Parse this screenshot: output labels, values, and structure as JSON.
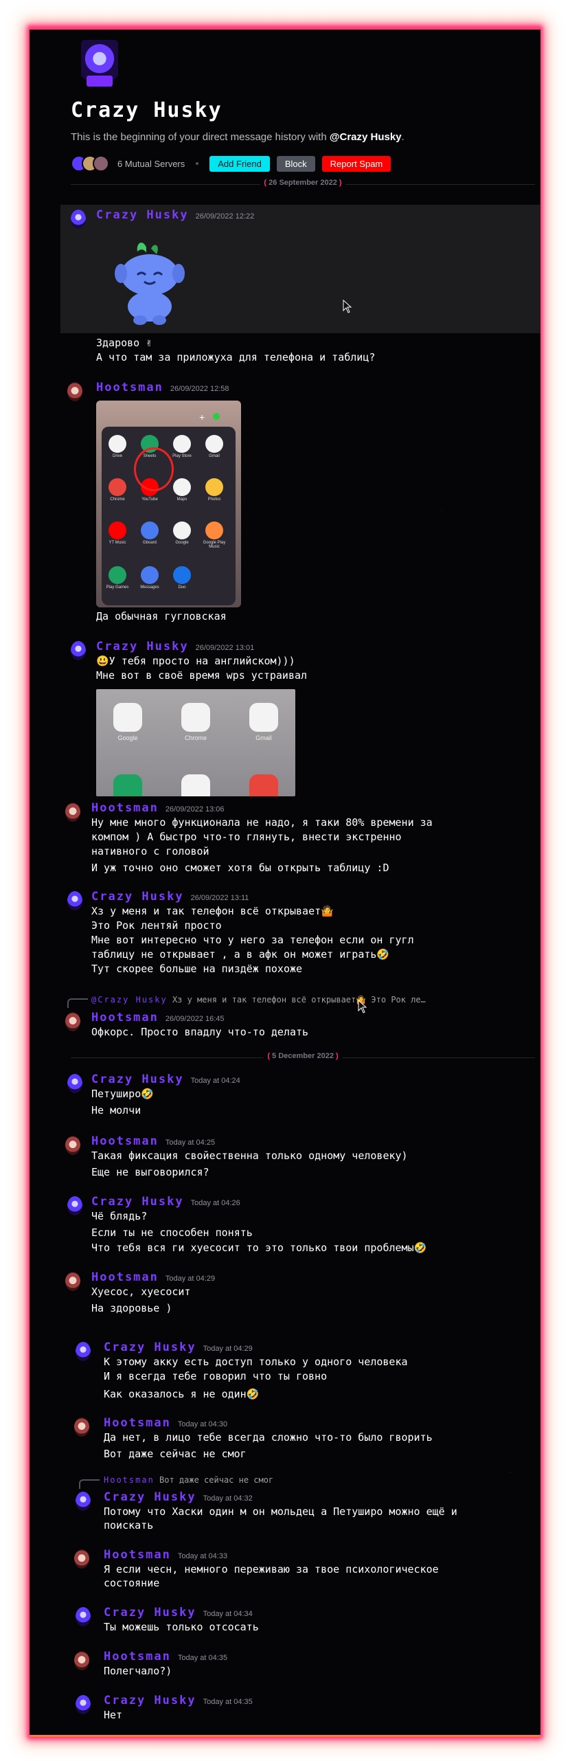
{
  "header": {
    "title": "Crazy Husky",
    "subtitle_prefix": "This is the beginning of your direct message history with ",
    "subtitle_user": "@Crazy Husky",
    "subtitle_suffix": ".",
    "mutual_servers": "6 Mutual Servers",
    "btn_add": "Add Friend",
    "btn_block": "Block",
    "btn_spam": "Report Spam"
  },
  "dividers": [
    "26 September 2022",
    "5 December 2022"
  ],
  "users": {
    "husky": "Crazy Husky",
    "hoots": "Hootsman"
  },
  "colors": {
    "accent": "#7b3cff",
    "add_friend": "#00e5f0",
    "block": "#4f545c",
    "report_spam": "#ff0000",
    "frame_glow": "#ff2d6e"
  },
  "images": {
    "phone_apps": [
      "Drive",
      "Sheets",
      "Play Store",
      "Gmail",
      "Chrome",
      "YouTube",
      "Maps",
      "Photos",
      "YT Music",
      "Gboard",
      "Google",
      "Google Play Music",
      "Play Games",
      "Messages",
      "Duo"
    ],
    "big_apps": [
      "Google",
      "Chrome",
      "Gmail"
    ]
  },
  "messages": [
    {
      "author": "Crazy Husky",
      "time": "26/09/2022 12:22",
      "lines": []
    },
    {
      "lines": [
        "Здарово ✌",
        "А что там за приложуха для телефона и таблиц?"
      ]
    },
    {
      "author": "Hootsman",
      "time": "26/09/2022 12:58",
      "lines": [
        "Да обычная гугловская"
      ]
    },
    {
      "author": "Crazy Husky",
      "time": "26/09/2022 13:01",
      "lines": [
        "😃У тебя просто на английском)))",
        "Мне вот в своё время wps устраивал"
      ]
    },
    {
      "author": "Hootsman",
      "time": "26/09/2022 13:06",
      "lines": [
        "Ну мне много функционала не надо, я таки 80% времени за",
        "компом ) А быстро что-то глянуть, внести экстренно",
        "нативного с головой",
        "И уж точно оно сможет хотя бы открыть таблицу :D"
      ]
    },
    {
      "author": "Crazy Husky",
      "time": "26/09/2022 13:11",
      "lines": [
        "Хз у меня и так телефон всё открывает🤷",
        "Это Рок лентяй просто",
        "Мне вот интересно что у него за телефон если он гугл",
        "таблицу не открывает , а в афк он может играть🤣",
        "Тут скорее больше на пиздёж похоже"
      ]
    },
    {
      "reply_name": "@Crazy Husky",
      "reply_text": "Хз у меня и так телефон всё открывает🤷 Это Рок ле…",
      "author": "Hootsman",
      "time": "26/09/2022 16:45",
      "lines": [
        "Офкорс. Просто впадлу что-то делать"
      ]
    },
    {
      "author": "Crazy Husky",
      "time": "Today at 04:24",
      "lines": [
        "Петуширо🤣",
        "Не молчи"
      ]
    },
    {
      "author": "Hootsman",
      "time": "Today at 04:25",
      "lines": [
        "Такая фиксация свойественна только одному человеку)",
        "Еще не выговорился?"
      ]
    },
    {
      "author": "Crazy Husky",
      "time": "Today at 04:26",
      "lines": [
        "Чё блядь?",
        "Если ты не способен понять",
        "Что тебя вся ги хуесосит то это только твои проблемы🤣"
      ]
    },
    {
      "author": "Hootsman",
      "time": "Today at 04:29",
      "lines": [
        "Хуесос, хуесосит",
        "На здоровье )"
      ]
    },
    {
      "author": "Crazy Husky",
      "time": "Today at 04:29",
      "lines": [
        "К этому акку есть доступ только у одного человека",
        "И я всегда тебе говорил что ты говно",
        "Как оказалось я не один🤣"
      ]
    },
    {
      "author": "Hootsman",
      "time": "Today at 04:30",
      "lines": [
        "Да нет, в лицо тебе всегда сложно что-то было гворить",
        "Вот даже сейчас не смог"
      ]
    },
    {
      "reply_name": "Hootsman",
      "reply_text": "Вот даже сейчас не смог",
      "author": "Crazy Husky",
      "time": "Today at 04:32",
      "lines": [
        "Потому что Хаски один м он мольдец а Петуширо можно ещё и",
        "поискать"
      ]
    },
    {
      "author": "Hootsman",
      "time": "Today at 04:33",
      "lines": [
        "Я если чесн, немного переживаю за твое психологическое",
        "состояние"
      ]
    },
    {
      "author": "Crazy Husky",
      "time": "Today at 04:34",
      "lines": [
        "Ты можешь только отсосать"
      ]
    },
    {
      "author": "Hootsman",
      "time": "Today at 04:35",
      "lines": [
        "Полегчало?)"
      ]
    },
    {
      "author": "Crazy Husky",
      "time": "Today at 04:35",
      "lines": [
        "Нет"
      ]
    }
  ]
}
